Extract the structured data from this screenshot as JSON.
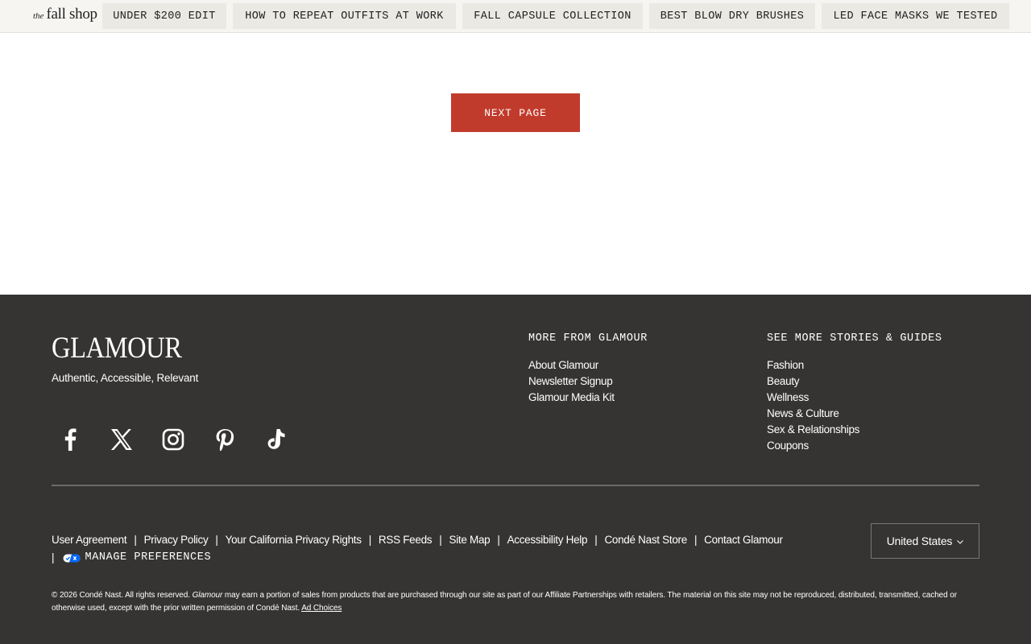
{
  "topbar": {
    "brand_prefix": "the",
    "brand_name": "fall shop",
    "chips": [
      "UNDER $200 EDIT",
      "HOW TO REPEAT OUTFITS AT WORK",
      "FALL CAPSULE COLLECTION",
      "BEST BLOW DRY BRUSHES",
      "LED FACE MASKS WE TESTED"
    ]
  },
  "main": {
    "next_page_label": "NEXT PAGE"
  },
  "footer": {
    "logo": "GLAMOUR",
    "tagline": "Authentic, Accessible, Relevant",
    "social_icons": [
      "facebook-icon",
      "x-icon",
      "instagram-icon",
      "pinterest-icon",
      "tiktok-icon"
    ],
    "more_from": {
      "heading": "MORE FROM GLAMOUR",
      "links": [
        "About Glamour",
        "Newsletter Signup",
        "Glamour Media Kit"
      ]
    },
    "see_more": {
      "heading": "SEE MORE STORIES & GUIDES",
      "links": [
        "Fashion",
        "Beauty",
        "Wellness",
        "News & Culture",
        "Sex & Relationships",
        "Coupons"
      ]
    },
    "legal_links": [
      "User Agreement",
      "Privacy Policy",
      "Your California Privacy Rights",
      "RSS Feeds",
      "Site Map",
      "Accessibility Help",
      "Condé Nast Store",
      "Contact Glamour"
    ],
    "separator": "|",
    "manage_preferences": "MANAGE PREFERENCES",
    "country": "United States",
    "copyright_start": "© 2026 Condé Nast. All rights reserved. ",
    "copyright_brand": "Glamour",
    "copyright_rest": " may earn a portion of sales from products that are purchased through our site as part of our Affiliate Partnerships with retailers. The material on this site may not be reproduced, distributed, transmitted, cached or otherwise used, except with the prior written permission of Condé Nast. ",
    "ad_choices": "Ad Choices"
  },
  "colors": {
    "accent": "#c13b2c",
    "footer_bg": "#353432",
    "topbar_bg": "#f6f5f2",
    "chip_bg": "#ebe9e4"
  }
}
